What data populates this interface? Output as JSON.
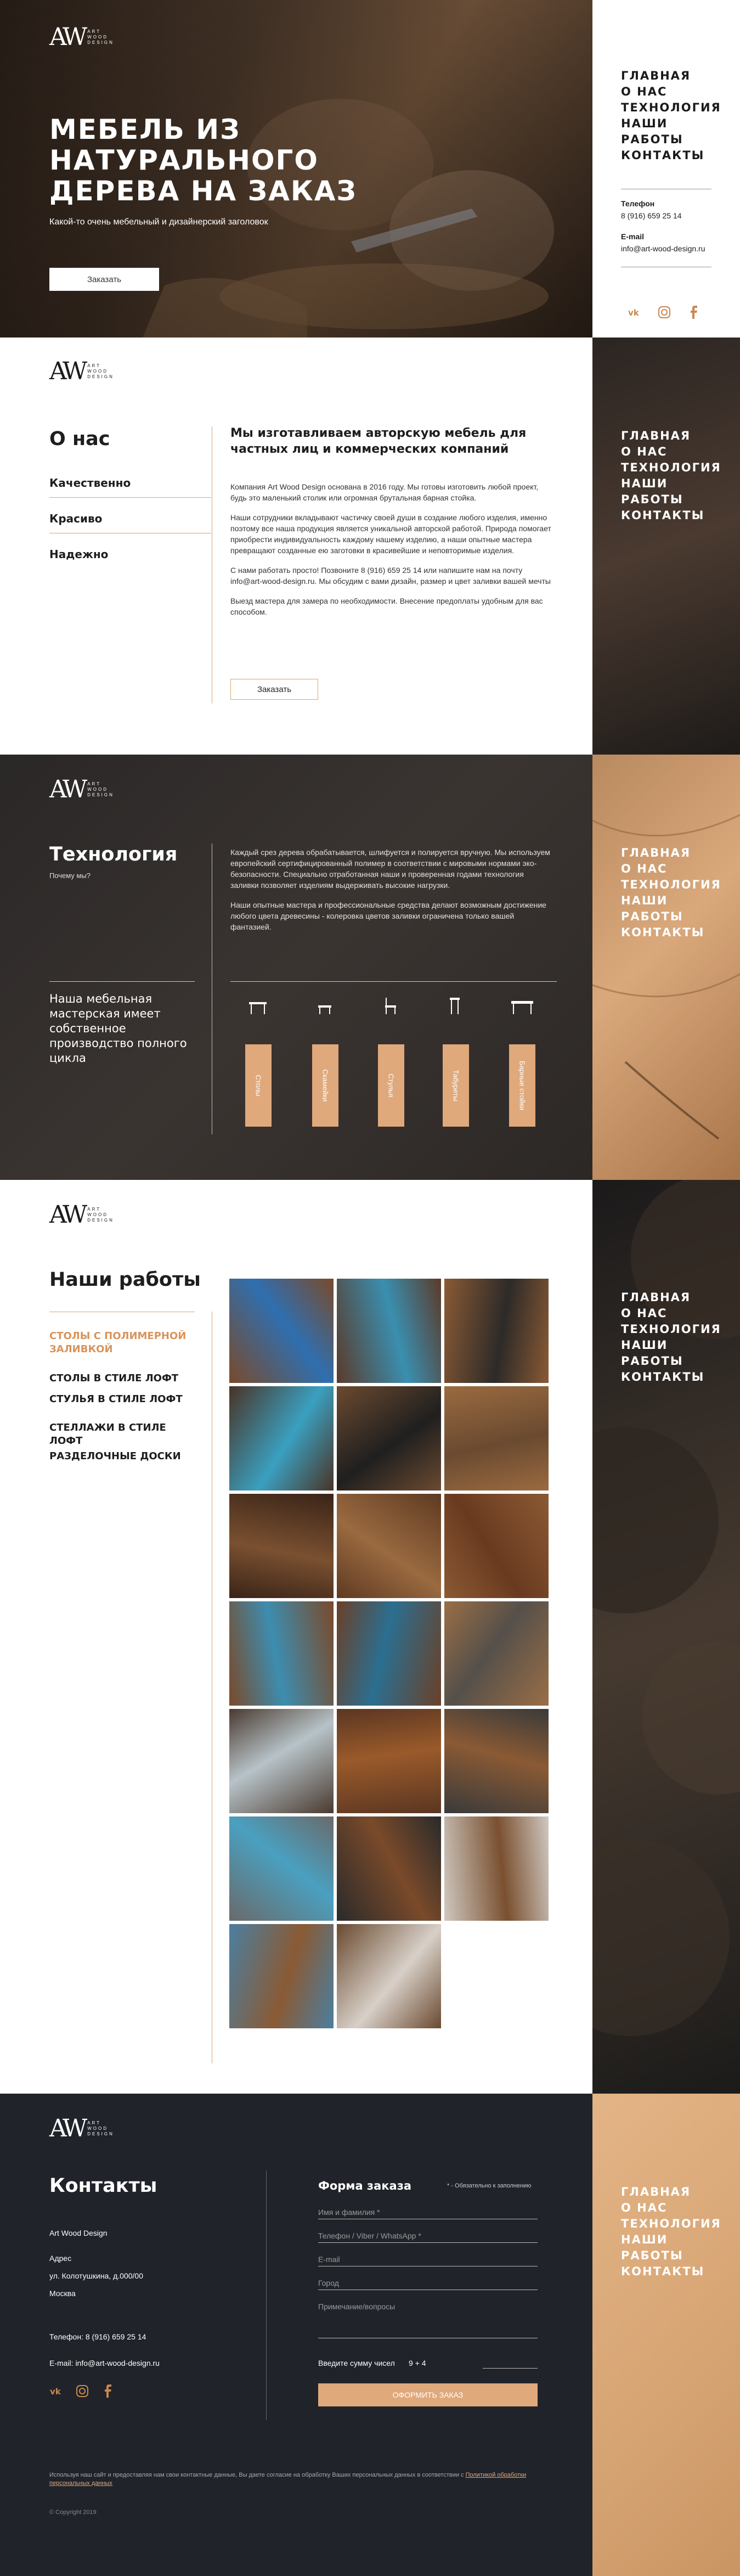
{
  "brand": {
    "mark": "AW",
    "line1": "ART",
    "line2": "WOOD",
    "line3": "DESIGN"
  },
  "nav": [
    "ГЛАВНАЯ",
    "О НАС",
    "ТЕХНОЛОГИЯ",
    "НАШИ РАБОТЫ",
    "КОНТАКТЫ"
  ],
  "hero": {
    "title": "МЕБЕЛЬ ИЗ НАТУРАЛЬНОГО ДЕРЕВА НА ЗАКАЗ",
    "subtitle": "Какой-то очень мебельный и дизайнерский заголовок",
    "button": "Заказать"
  },
  "side_contacts": {
    "phone_label": "Телефон",
    "phone": "8 (916) 659 25 14",
    "email_label": "E-mail",
    "email": "info@art-wood-design.ru"
  },
  "social": [
    "vk-icon",
    "instagram-icon",
    "facebook-icon"
  ],
  "about": {
    "title": "О нас",
    "features": [
      "Качественно",
      "Красиво",
      "Надежно"
    ],
    "heading": "Мы изготавливаем авторскую мебель для частных лиц и коммерческих компаний",
    "p1": "Компания Art Wood Design основана в 2016 году. Мы готовы изготовить любой проект, будь это маленький столик или огромная брутальная барная стойка.",
    "p2": "Наши сотрудники вкладывают частичку своей души в создание любого изделия, именно поэтому все наша продукция является уникальной авторской работой. Природа помогает приобрести индивидуальность каждому нашему изделию, а наши опытные мастера превращают созданные ею заготовки в красивейшие и неповторимые изделия.",
    "p3": "С нами работать просто! Позвоните 8 (916) 659 25 14 или напишите нам на почту info@art-wood-design.ru. Мы обсудим с вами дизайн, размер и цвет заливки вашей мечты",
    "p4": "Выезд мастера для замера по необходимости. Внесение предоплаты удобным для вас способом.",
    "button": "Заказать"
  },
  "tech": {
    "title": "Технология",
    "subtitle": "Почему мы?",
    "p1": "Каждый срез дерева обрабатывается, шлифуется и полируется вручную. Мы используем европейский сертифицированный полимер в соответствии с мировыми нормами эко-безопасности. Специально отработанная наши и проверенная годами технология заливки позволяет изделиям выдерживать высокие нагрузки.",
    "p2": "Наши опытные мастера и профессиональные средства делают возможным достижение любого цвета древесины - колеровка цветов заливки ограничена только вашей фантазией.",
    "side_note": "Наша мебельная мастерская имеет собственное производство полного цикла",
    "cards": [
      "Столы",
      "Скамейки",
      "Стулья",
      "Табуреты",
      "Барные стойки"
    ],
    "card_icons": [
      "table-icon",
      "bench-icon",
      "chair-icon",
      "stool-icon",
      "bar-counter-icon"
    ]
  },
  "works": {
    "title": "Наши работы",
    "categories": [
      "СТОЛЫ С ПОЛИМЕРНОЙ ЗАЛИВКОЙ",
      "СТОЛЫ В СТИЛЕ ЛОФТ",
      "СТУЛЬЯ В СТИЛЕ ЛОФТ",
      "СТЕЛЛАЖИ В СТИЛЕ ЛОФТ",
      "РАЗДЕЛОЧНЫЕ ДОСКИ"
    ],
    "active_color": "#d9935a"
  },
  "contacts": {
    "title": "Контакты",
    "company": "Art Wood Design",
    "address_label": "Адрес",
    "address_line": "ул. Колотушкина, д.000/00",
    "city": "Москва",
    "phone": "Телефон: 8 (916) 659 25 14",
    "email": "E-mail: info@art-wood-design.ru"
  },
  "form": {
    "title": "Форма заказа",
    "note": "* - Обязательно к заполнению",
    "fields": [
      "Имя и фамилия *",
      "Телефон / Viber / WhatsApp *",
      "E-mail",
      "Город",
      "Примечание/вопросы"
    ],
    "captcha_label": "Введите сумму чисел",
    "captcha_expr": "9 + 4",
    "submit": "ОФОРМИТЬ ЗАКАЗ"
  },
  "footer": {
    "consent": "Используя наш сайт и предоставляя нам свои контактные данные, Вы даете согласие на обработку Ваших персональных данных в соответствии с",
    "consent_link": "Политикой обработки персональных данных",
    "copyright": "© Copyright 2019"
  },
  "colors": {
    "accent": "#dfa97c",
    "dark": "#20232a"
  }
}
